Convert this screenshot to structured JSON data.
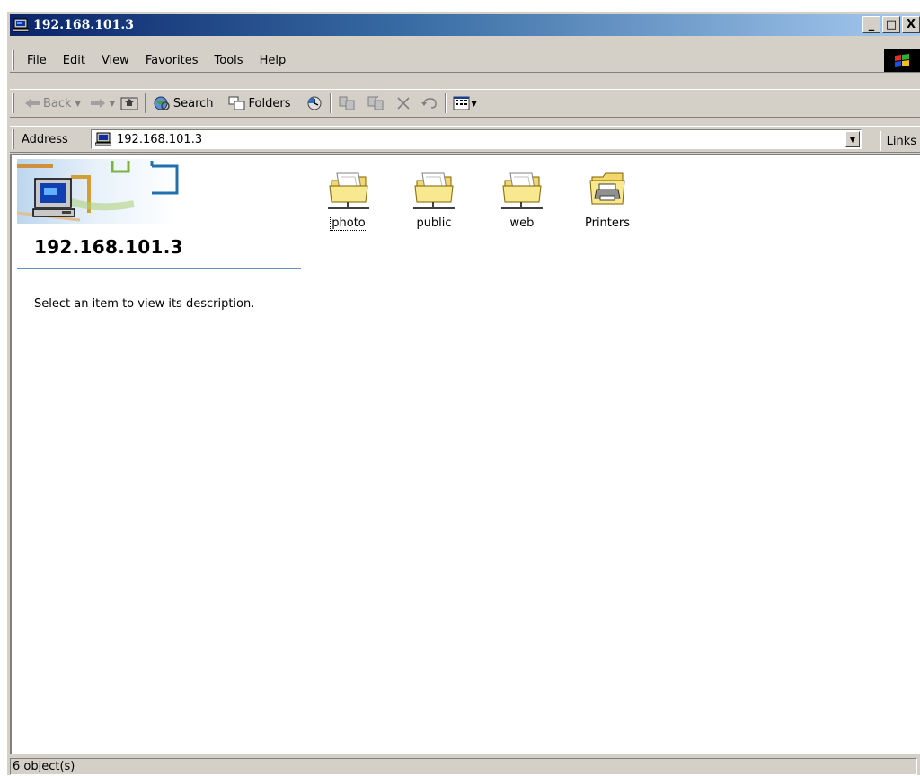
{
  "window": {
    "title": "192.168.101.3",
    "controls": [
      "_",
      "□",
      "X"
    ]
  },
  "menu": {
    "items": [
      "File",
      "Edit",
      "View",
      "Favorites",
      "Tools",
      "Help"
    ]
  },
  "toolbar": {
    "back_label": "Back",
    "search_label": "Search",
    "folders_label": "Folders"
  },
  "address": {
    "label": "Address",
    "value": "192.168.101.3",
    "links_label": "Links"
  },
  "leftpane": {
    "title": "192.168.101.3",
    "description": "Select an item to view its description."
  },
  "items": [
    {
      "label": "photo",
      "icon": "shared-folder-icon",
      "selected": true
    },
    {
      "label": "public",
      "icon": "shared-folder-icon",
      "selected": false
    },
    {
      "label": "web",
      "icon": "shared-folder-icon",
      "selected": false
    },
    {
      "label": "Printers",
      "icon": "printers-folder-icon",
      "selected": false
    }
  ],
  "status": {
    "text": "6 object(s)"
  }
}
